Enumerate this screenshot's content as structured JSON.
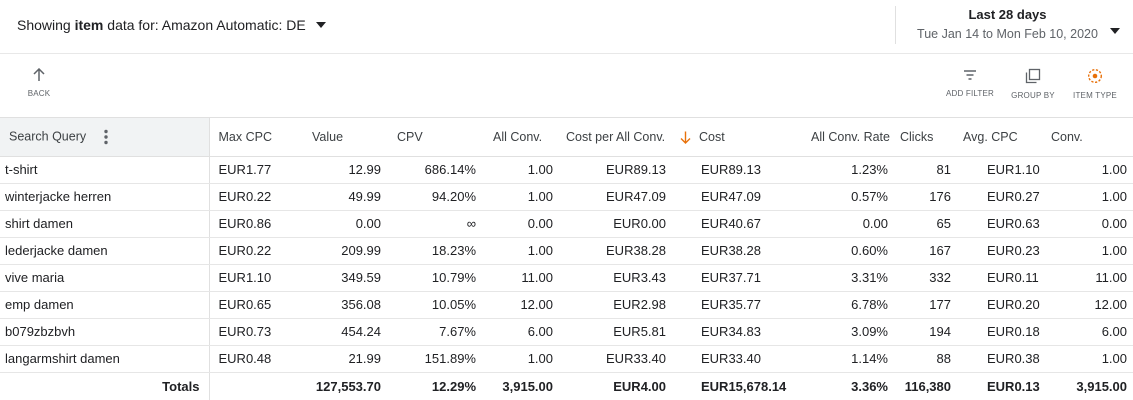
{
  "header": {
    "source_prefix": "Showing",
    "source_bold": "item",
    "source_suffix": "data for: Amazon Automatic: DE",
    "date_title": "Last 28 days",
    "date_range": "Tue Jan 14 to Mon Feb 10, 2020"
  },
  "toolbar": {
    "back": "BACK",
    "add_filter": "ADD FILTER",
    "group_by": "GROUP BY",
    "item_type": "ITEM TYPE"
  },
  "table": {
    "columns": [
      "Search Query",
      "Max CPC",
      "Value",
      "CPV",
      "All Conv.",
      "Cost per All Conv.",
      "Cost",
      "All Conv. Rate",
      "Clicks",
      "Avg. CPC",
      "Conv."
    ],
    "rows": [
      [
        "t-shirt",
        "EUR1.77",
        "12.99",
        "686.14%",
        "1.00",
        "EUR89.13",
        "EUR89.13",
        "1.23%",
        "81",
        "EUR1.10",
        "1.00"
      ],
      [
        "winterjacke herren",
        "EUR0.22",
        "49.99",
        "94.20%",
        "1.00",
        "EUR47.09",
        "EUR47.09",
        "0.57%",
        "176",
        "EUR0.27",
        "1.00"
      ],
      [
        "shirt damen",
        "EUR0.86",
        "0.00",
        "∞",
        "0.00",
        "EUR0.00",
        "EUR40.67",
        "0.00",
        "65",
        "EUR0.63",
        "0.00"
      ],
      [
        "lederjacke damen",
        "EUR0.22",
        "209.99",
        "18.23%",
        "1.00",
        "EUR38.28",
        "EUR38.28",
        "0.60%",
        "167",
        "EUR0.23",
        "1.00"
      ],
      [
        "vive maria",
        "EUR1.10",
        "349.59",
        "10.79%",
        "11.00",
        "EUR3.43",
        "EUR37.71",
        "3.31%",
        "332",
        "EUR0.11",
        "11.00"
      ],
      [
        "emp damen",
        "EUR0.65",
        "356.08",
        "10.05%",
        "12.00",
        "EUR2.98",
        "EUR35.77",
        "6.78%",
        "177",
        "EUR0.20",
        "12.00"
      ],
      [
        "b079zbzbvh",
        "EUR0.73",
        "454.24",
        "7.67%",
        "6.00",
        "EUR5.81",
        "EUR34.83",
        "3.09%",
        "194",
        "EUR0.18",
        "6.00"
      ],
      [
        "langarmshirt damen",
        "EUR0.48",
        "21.99",
        "151.89%",
        "1.00",
        "EUR33.40",
        "EUR33.40",
        "1.14%",
        "88",
        "EUR0.38",
        "1.00"
      ]
    ],
    "totals": [
      "Totals",
      "",
      "127,553.70",
      "12.29%",
      "3,915.00",
      "EUR4.00",
      "EUR15,678.14",
      "3.36%",
      "116,380",
      "EUR0.13",
      "3,915.00"
    ]
  },
  "colors": {
    "sort_arrow": "#e8710a",
    "item_type_icon": "#e8710a",
    "icon_gray": "#5f6368"
  }
}
